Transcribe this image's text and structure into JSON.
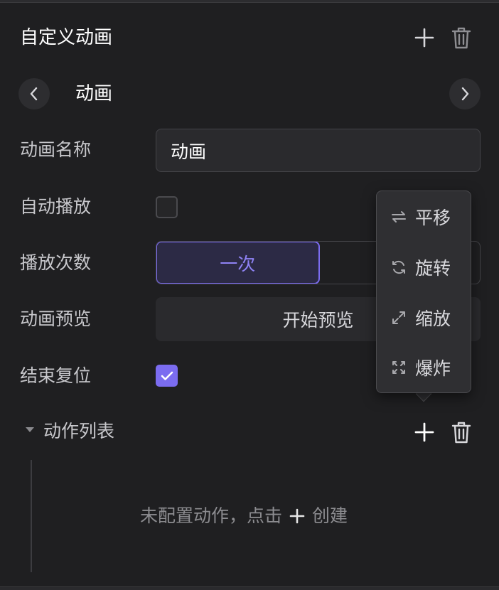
{
  "panel": {
    "title": "自定义动画"
  },
  "navigator": {
    "name": "动画"
  },
  "form": {
    "name_label": "动画名称",
    "name_value": "动画",
    "autoplay_label": "自动播放",
    "autoplay_checked": false,
    "playcount_label": "播放次数",
    "playcount_options": [
      "一次",
      ""
    ],
    "playcount_selected": "一次",
    "preview_label": "动画预览",
    "preview_button": "开始预览",
    "reset_label": "结束复位",
    "reset_checked": true
  },
  "actions": {
    "title": "动作列表",
    "empty_prefix": "未配置动作，点击",
    "empty_suffix": "创建"
  },
  "menu": {
    "items": [
      {
        "label": "平移",
        "icon": "swap-icon"
      },
      {
        "label": "旋转",
        "icon": "rotate-icon"
      },
      {
        "label": "缩放",
        "icon": "expand-icon"
      },
      {
        "label": "爆炸",
        "icon": "explode-icon"
      }
    ]
  },
  "colors": {
    "accent": "#7b6cf0",
    "background": "#1f1f21"
  }
}
